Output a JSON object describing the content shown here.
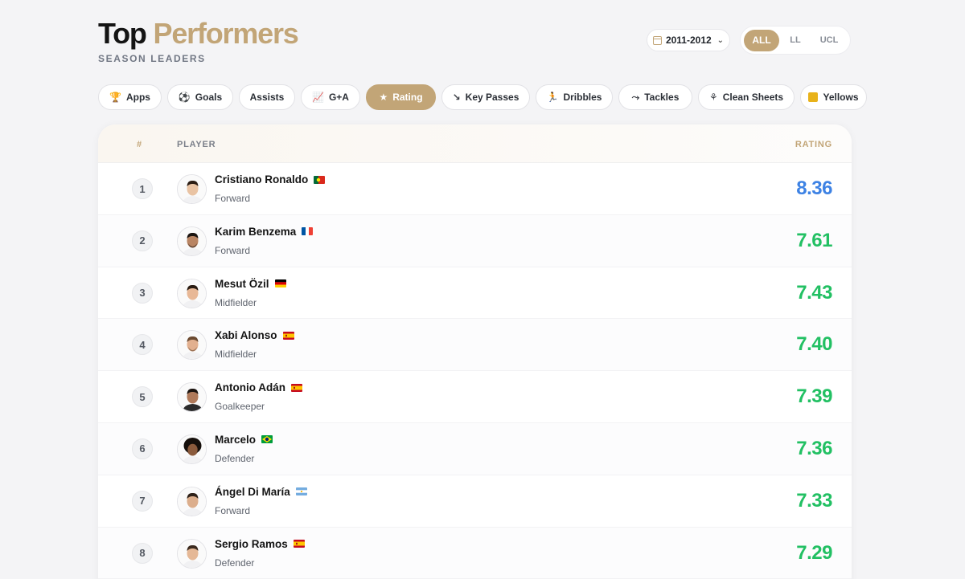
{
  "header": {
    "title_part1": "Top",
    "title_part2": "Performers",
    "subtitle": "SEASON LEADERS"
  },
  "season": {
    "value": "2011-2012"
  },
  "competitions": {
    "options": [
      "ALL",
      "LL",
      "UCL"
    ],
    "selected": "ALL"
  },
  "stat_tabs": [
    {
      "label": "Apps",
      "icon": "trophy-icon"
    },
    {
      "label": "Goals",
      "icon": "soccer-ball-icon"
    },
    {
      "label": "Assists",
      "icon": ""
    },
    {
      "label": "G+A",
      "icon": "line-chart-icon"
    },
    {
      "label": "Rating",
      "icon": "star-icon",
      "active": true
    },
    {
      "label": "Key Passes",
      "icon": "key-pass-icon"
    },
    {
      "label": "Dribbles",
      "icon": "runner-icon"
    },
    {
      "label": "Tackles",
      "icon": "tackle-icon"
    },
    {
      "label": "Clean Sheets",
      "icon": "goalkeeper-icon"
    },
    {
      "label": "Yellows",
      "icon": "yellow-card-icon"
    }
  ],
  "table": {
    "columns": {
      "rank": "#",
      "player": "PLAYER",
      "stat": "RATING"
    },
    "rows": [
      {
        "rank": "1",
        "name": "Cristiano Ronaldo",
        "flag": "portugal-flag",
        "position": "Forward",
        "value": "8.36"
      },
      {
        "rank": "2",
        "name": "Karim Benzema",
        "flag": "france-flag",
        "position": "Forward",
        "value": "7.61"
      },
      {
        "rank": "3",
        "name": "Mesut Özil",
        "flag": "germany-flag",
        "position": "Midfielder",
        "value": "7.43"
      },
      {
        "rank": "4",
        "name": "Xabi Alonso",
        "flag": "spain-flag",
        "position": "Midfielder",
        "value": "7.40"
      },
      {
        "rank": "5",
        "name": "Antonio Adán",
        "flag": "spain-flag",
        "position": "Goalkeeper",
        "value": "7.39"
      },
      {
        "rank": "6",
        "name": "Marcelo",
        "flag": "brazil-flag",
        "position": "Defender",
        "value": "7.36"
      },
      {
        "rank": "7",
        "name": "Ángel Di María",
        "flag": "argentina-flag",
        "position": "Forward",
        "value": "7.33"
      },
      {
        "rank": "8",
        "name": "Sergio Ramos",
        "flag": "spain-flag",
        "position": "Defender",
        "value": "7.29"
      }
    ]
  },
  "colors": {
    "accent": "#c2a577",
    "top_value": "#3d82e4",
    "value": "#22c063",
    "yellow_card": "#e8b21a"
  }
}
